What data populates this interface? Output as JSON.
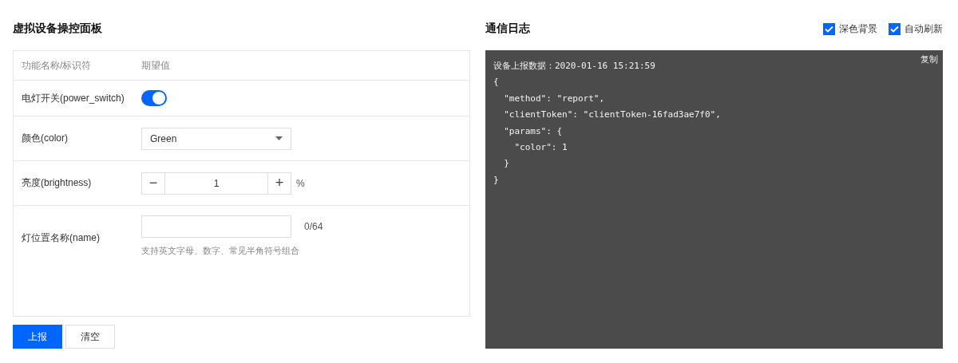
{
  "panel": {
    "title": "虚拟设备操控面板",
    "table": {
      "columns": [
        "功能名称/标识符",
        "期望值"
      ],
      "rows": [
        {
          "kind": "switch",
          "label": "电灯开关(power_switch)",
          "on": true
        },
        {
          "kind": "select",
          "label": "颜色(color)",
          "value": "Green"
        },
        {
          "kind": "stepper",
          "label": "亮度(brightness)",
          "minus": "−",
          "value": "1",
          "plus": "+",
          "unit": "%"
        },
        {
          "kind": "text",
          "label": "灯位置名称(name)",
          "counter": "0/64",
          "hint": "支持英文字母、数字、常见半角符号组合"
        }
      ]
    },
    "buttons": [
      {
        "label": "上报",
        "primary": true
      },
      {
        "label": "清空",
        "primary": false
      }
    ]
  },
  "log": {
    "title": "通信日志",
    "options": [
      {
        "label": "深色背景",
        "checked": true
      },
      {
        "label": "自动刷新",
        "checked": true
      }
    ],
    "copy": "复制",
    "lines": [
      "设备上报数据：2020-01-16 15:21:59",
      "{",
      "  \"method\": \"report\",",
      "  \"clientToken\": \"clientToken-16fad3ae7f0\",",
      "  \"params\": {",
      "    \"color\": 1",
      "  }",
      "}"
    ]
  }
}
